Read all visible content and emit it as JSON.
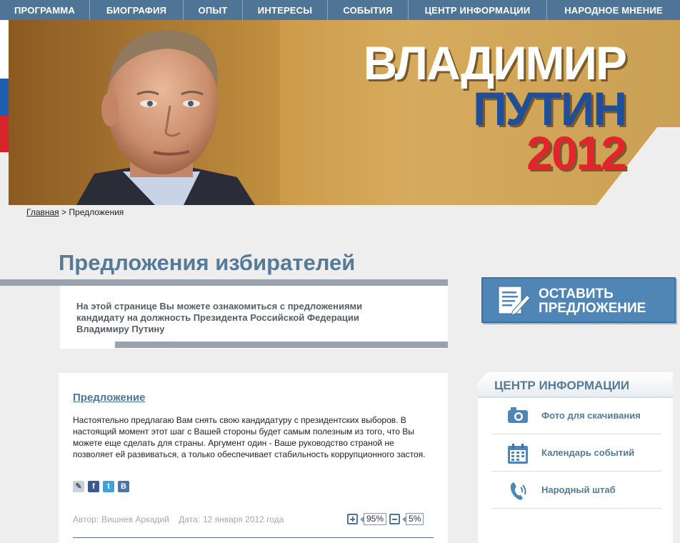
{
  "nav": {
    "items": [
      "ПРОГРАММА",
      "БИОГРАФИЯ",
      "ОПЫТ",
      "ИНТЕРЕСЫ",
      "СОБЫТИЯ",
      "ЦЕНТР ИНФОРМАЦИИ",
      "НАРОДНОЕ МНЕНИЕ"
    ]
  },
  "banner": {
    "first_name": "ВЛАДИМИР",
    "last_name": "ПУТИН",
    "year": "2012"
  },
  "breadcrumb": {
    "home": "Главная",
    "separator": ">",
    "current": "Предложения"
  },
  "page": {
    "title": "Предложения избирателей",
    "intro": "На этой странице Вы можете ознакомиться с предложениями кандидату на должность Президента Российской Федерации Владимиру Путину"
  },
  "cta": {
    "line1": "ОСТАВИТЬ",
    "line2": "ПРЕДЛОЖЕНИЕ"
  },
  "proposal": {
    "title": "Предложение",
    "body": "Настоятельно предлагаю Вам снять свою кандидатуру с президентских выборов. В настоящий момент этот шаг с Вашей стороны будет самым полезным из того, что Вы можете еще сделать для страны. Аргумент один - Ваше руководство страной не позволяет ей развиваться, а только обеспечивает стабильность коррупционного застоя.",
    "share_icons": [
      "livejournal-icon",
      "facebook-icon",
      "twitter-icon",
      "vkontakte-icon"
    ],
    "author_label": "Автор:",
    "author": "Вишнев Аркадий",
    "date_label": "Дата:",
    "date": "12 января 2012 года",
    "votes_for": "95%",
    "votes_against": "5%"
  },
  "info_center": {
    "title": "ЦЕНТР ИНФОРМАЦИИ",
    "items": [
      {
        "label": "Фото для скачивания",
        "icon": "camera-icon"
      },
      {
        "label": "Календарь событий",
        "icon": "calendar-icon"
      },
      {
        "label": "Народный штаб",
        "icon": "phone-icon"
      }
    ]
  },
  "colors": {
    "nav_bg": "#4f7596",
    "accent": "#577a96",
    "cta_bg": "#4f86b5",
    "name_blue": "#1f4e9a",
    "year_red": "#e2242c"
  }
}
